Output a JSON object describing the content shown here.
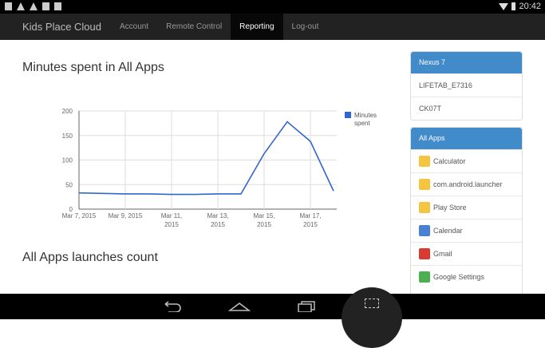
{
  "status": {
    "time": "20:42"
  },
  "nav": {
    "brand": "Kids Place Cloud",
    "items": [
      "Account",
      "Remote Control",
      "Reporting",
      "Log-out"
    ],
    "active": "Reporting"
  },
  "main": {
    "title1": "Minutes spent in All Apps",
    "title2": "All Apps launches count"
  },
  "chart_data": {
    "type": "line",
    "title": "Minutes spent in All Apps",
    "xlabel": "",
    "ylabel": "",
    "x": [
      "Mar 7, 2015",
      "Mar 8, 2015",
      "Mar 9, 2015",
      "Mar 10, 2015",
      "Mar 11, 2015",
      "Mar 12, 2015",
      "Mar 13, 2015",
      "Mar 14, 2015",
      "Mar 15, 2015",
      "Mar 16, 2015",
      "Mar 17, 2015",
      "Mar 18, 2015"
    ],
    "series": [
      {
        "name": "Minutes spent",
        "color": "#3366cc",
        "values": [
          33,
          32,
          31,
          31,
          30,
          30,
          31,
          31,
          113,
          178,
          138,
          37
        ]
      }
    ],
    "ylim": [
      0,
      200
    ],
    "yticks": [
      0,
      50,
      100,
      150,
      200
    ],
    "xticks": [
      [
        "Mar 7, 2015"
      ],
      [
        "Mar 9, 2015"
      ],
      [
        "Mar 11,",
        "2015"
      ],
      [
        "Mar 13,",
        "2015"
      ],
      [
        "Mar 15,",
        "2015"
      ],
      [
        "Mar 17,",
        "2015"
      ]
    ],
    "legend": [
      "Minutes",
      "spent"
    ],
    "legend_position": "right",
    "grid": true
  },
  "sidebar": {
    "devices_header": "Nexus 7",
    "devices": [
      "LIFETAB_E7316",
      "CK07T"
    ],
    "apps_header": "All Apps",
    "apps": [
      {
        "name": "Calculator",
        "icon": "default-app-icon"
      },
      {
        "name": "com.android.launcher",
        "icon": "default-app-icon"
      },
      {
        "name": "Play Store",
        "icon": "default-app-icon"
      },
      {
        "name": "Calendar",
        "icon": "calendar-icon"
      },
      {
        "name": "Gmail",
        "icon": "gmail-icon"
      },
      {
        "name": "Google Settings",
        "icon": "google-settings-icon"
      }
    ]
  }
}
